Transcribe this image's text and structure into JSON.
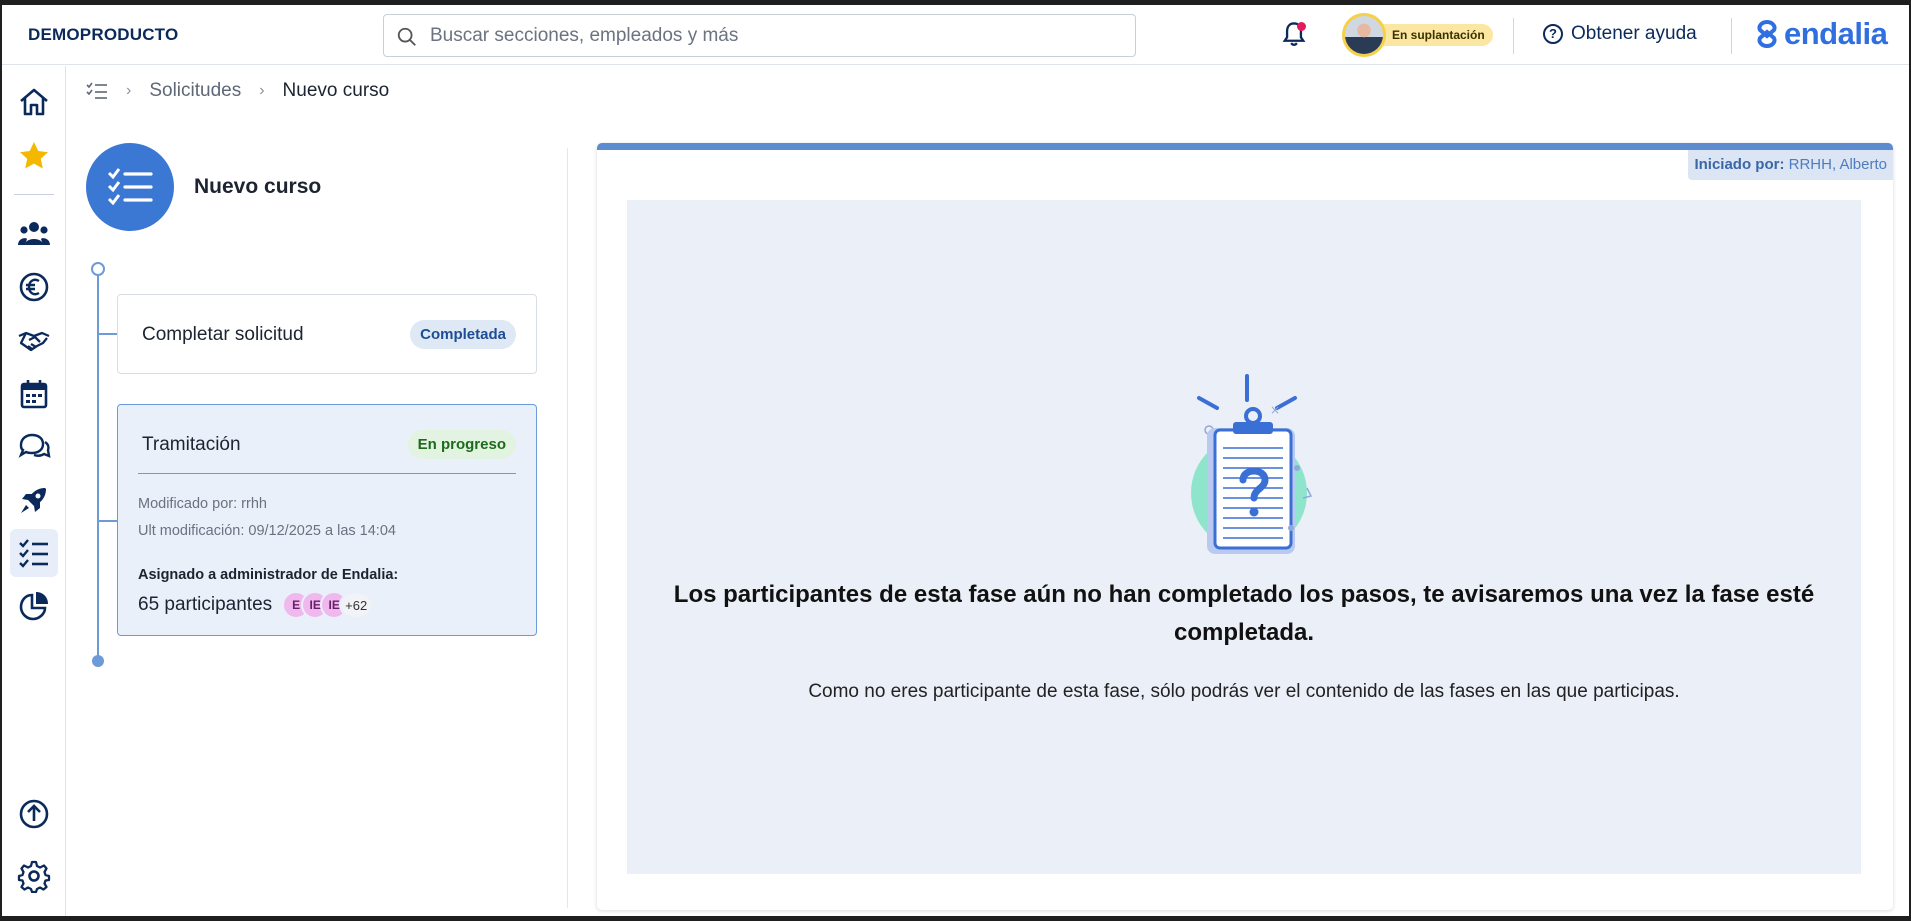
{
  "topbar": {
    "company": "DEMOPRODUCTO",
    "search_placeholder": "Buscar secciones, empleados y más",
    "impersonation_label": "En suplantación",
    "help_label": "Obtener ayuda",
    "brand": "endalia"
  },
  "sidebar": {
    "items": [
      {
        "icon": "home-icon"
      },
      {
        "icon": "star-icon"
      },
      {
        "icon": "people-icon"
      },
      {
        "icon": "euro-icon"
      },
      {
        "icon": "handshake-icon"
      },
      {
        "icon": "calendar-icon"
      },
      {
        "icon": "chat-icon"
      },
      {
        "icon": "rocket-icon"
      },
      {
        "icon": "checklist-icon",
        "active": true
      },
      {
        "icon": "pie-chart-icon"
      },
      {
        "icon": "upload-icon"
      },
      {
        "icon": "gear-icon"
      }
    ]
  },
  "breadcrumb": {
    "parent": "Solicitudes",
    "current": "Nuevo curso"
  },
  "process": {
    "title": "Nuevo curso"
  },
  "phases": [
    {
      "title": "Completar solicitud",
      "status": "Completada"
    },
    {
      "title": "Tramitación",
      "status": "En progreso",
      "modified_by": "Modificado por: rrhh",
      "last_modified": "Ult modificación: 09/12/2025 a las 14:04",
      "assigned_label": "Asignado a administrador de Endalia:",
      "participants_count": "65 participantes",
      "avatars": [
        "E",
        "IE",
        "IE"
      ],
      "more": "+62"
    }
  ],
  "main": {
    "initiated_label": "Iniciado por:",
    "initiated_by": "RRHH, Alberto",
    "empty_title": "Los participantes de esta fase aún no han completado los pasos, te avisaremos una vez la fase esté completada.",
    "empty_subtitle": "Como no eres participante de esta fase, sólo podrás ver el contenido de las fases en las que participas."
  },
  "colors": {
    "accent": "#3a78d4",
    "brand": "#2f6fe0",
    "nav": "#0b2a5b",
    "completed_pill": "#dfe8f5",
    "progress_pill": "#e3f3e1"
  }
}
